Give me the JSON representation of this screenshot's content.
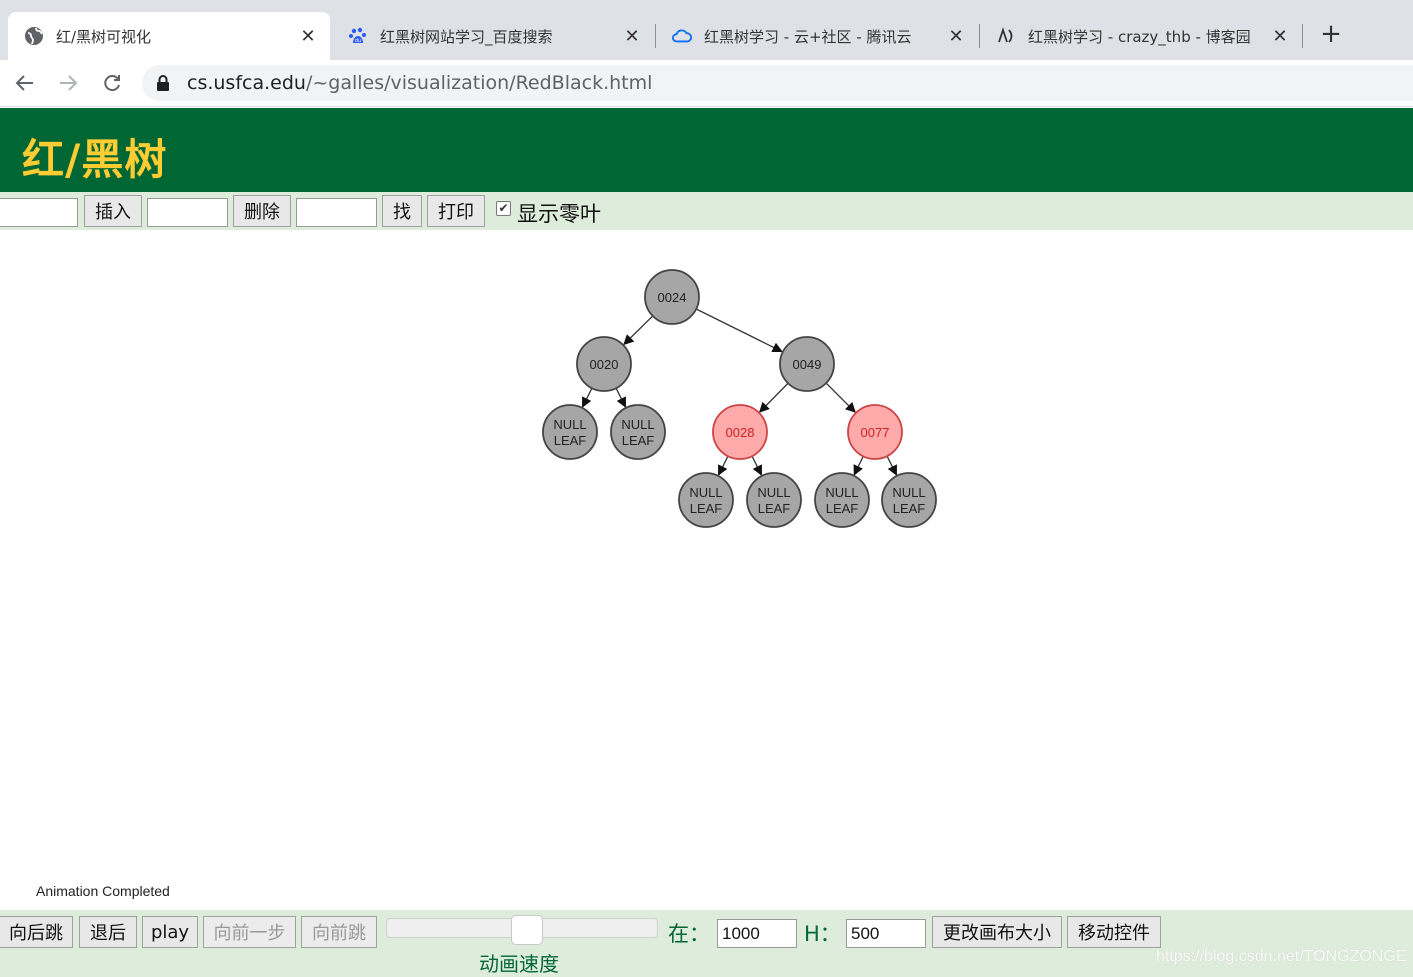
{
  "browser": {
    "tabs": [
      {
        "title": "红/黑树可视化",
        "active": true
      },
      {
        "title": "红黑树网站学习_百度搜索",
        "active": false
      },
      {
        "title": "红黑树学习 - 云+社区 - 腾讯云",
        "active": false
      },
      {
        "title": "红黑树学习 - crazy_thb - 博客园",
        "active": false
      }
    ],
    "url_host": "cs.usfca.edu",
    "url_path": "/~galles/visualization/RedBlack.html"
  },
  "page": {
    "title": "红/黑树",
    "controls": {
      "insert_label": "插入",
      "delete_label": "删除",
      "find_label": "找",
      "print_label": "打印",
      "show_null_leaves_label": "显示零叶",
      "show_null_leaves_checked": true,
      "insert_value": "",
      "delete_value": "",
      "find_value": ""
    },
    "status": "Animation Completed",
    "animation": {
      "skip_back_label": "向后跳",
      "step_back_label": "退后",
      "play_label": "play",
      "step_forward_label": "向前一步",
      "skip_forward_label": "向前跳",
      "speed_label": "动画速度",
      "speed_fraction": 0.47,
      "width_label": "在：",
      "width_value": "1000",
      "height_label": "H：",
      "height_value": "500",
      "resize_label": "更改画布大小",
      "move_controls_label": "移动控件"
    },
    "watermark": "https://blog.csdn.net/TONGZONGE"
  },
  "tree": {
    "null_leaf_text": [
      "NULL",
      "LEAF"
    ],
    "colors": {
      "black": "#a6a6a6",
      "red": "#ffaaaa",
      "red_stroke": "#cc4444",
      "black_stroke": "#444444"
    },
    "nodes": [
      {
        "key": "0024",
        "color": "black",
        "level": 0
      },
      {
        "key": "0020",
        "color": "black",
        "level": 1
      },
      {
        "key": "0049",
        "color": "black",
        "level": 1
      },
      {
        "key": "0028",
        "color": "red",
        "level": 2
      },
      {
        "key": "0077",
        "color": "red",
        "level": 2
      }
    ]
  }
}
